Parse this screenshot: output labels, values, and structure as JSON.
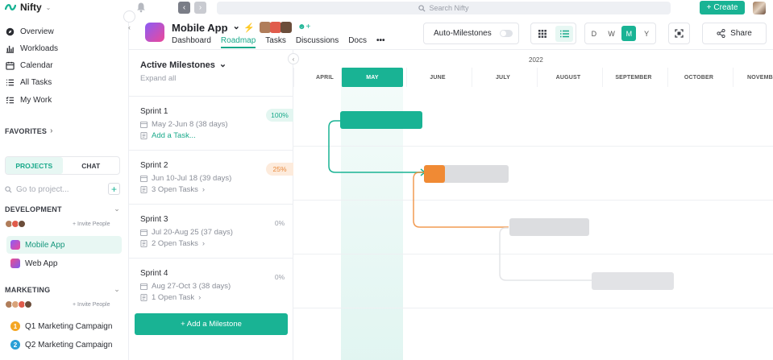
{
  "brand": {
    "name": "Nifty"
  },
  "search": {
    "placeholder": "Search Nifty"
  },
  "create": {
    "label": "Create"
  },
  "sidebar": {
    "nav": [
      {
        "label": "Overview",
        "icon": "overview-icon"
      },
      {
        "label": "Workloads",
        "icon": "workloads-icon"
      },
      {
        "label": "Calendar",
        "icon": "calendar-icon"
      },
      {
        "label": "All Tasks",
        "icon": "list-icon"
      },
      {
        "label": "My Work",
        "icon": "checklist-icon"
      }
    ],
    "favorites": "FAVORITES",
    "tabs": {
      "projects": "PROJECTS",
      "chat": "CHAT"
    },
    "goto_placeholder": "Go to project...",
    "groups": [
      {
        "name": "DEVELOPMENT",
        "invite": "+ Invite People",
        "projects": [
          {
            "name": "Mobile App",
            "active": true
          },
          {
            "name": "Web App",
            "active": false
          }
        ]
      },
      {
        "name": "MARKETING",
        "invite": "+ Invite People",
        "projects": [
          {
            "name": "Q1 Marketing Campaign",
            "badge": "1",
            "color": "#f4a623"
          },
          {
            "name": "Q2 Marketing Campaign",
            "badge": "2",
            "color": "#2a9fd6"
          }
        ]
      }
    ]
  },
  "project": {
    "title": "Mobile App",
    "tabs": [
      "Dashboard",
      "Roadmap",
      "Tasks",
      "Discussions",
      "Docs"
    ],
    "active_tab": "Roadmap",
    "more": "•••",
    "auto_milestones": "Auto-Milestones",
    "scale": [
      "D",
      "W",
      "M",
      "Y"
    ],
    "active_scale": "M",
    "share": "Share"
  },
  "milestones": {
    "title": "Active Milestones",
    "expand": "Expand all",
    "add": "+ Add a Milestone",
    "items": [
      {
        "name": "Sprint 1",
        "dates": "May 2-Jun 8 (38 days)",
        "tasks": "Add a Task...",
        "percent": "100%",
        "status": "done"
      },
      {
        "name": "Sprint 2",
        "dates": "Jun 10-Jul 18 (39 days)",
        "tasks": "3 Open Tasks",
        "percent": "25%",
        "status": "warn"
      },
      {
        "name": "Sprint 3",
        "dates": "Jul 20-Aug 25 (37 days)",
        "tasks": "2 Open Tasks",
        "percent": "0%",
        "status": "none"
      },
      {
        "name": "Sprint 4",
        "dates": "Aug 27-Oct 3 (38 days)",
        "tasks": "1 Open Task",
        "percent": "0%",
        "status": "none"
      }
    ]
  },
  "timeline": {
    "year": "2022",
    "months": [
      "APRIL",
      "MAY",
      "JUNE",
      "JULY",
      "AUGUST",
      "SEPTEMBER",
      "OCTOBER",
      "NOVEMBER"
    ],
    "active_month": "MAY"
  },
  "colors": {
    "accent": "#19b394",
    "warn": "#f08a34",
    "grey_bar": "#dcdde0"
  }
}
